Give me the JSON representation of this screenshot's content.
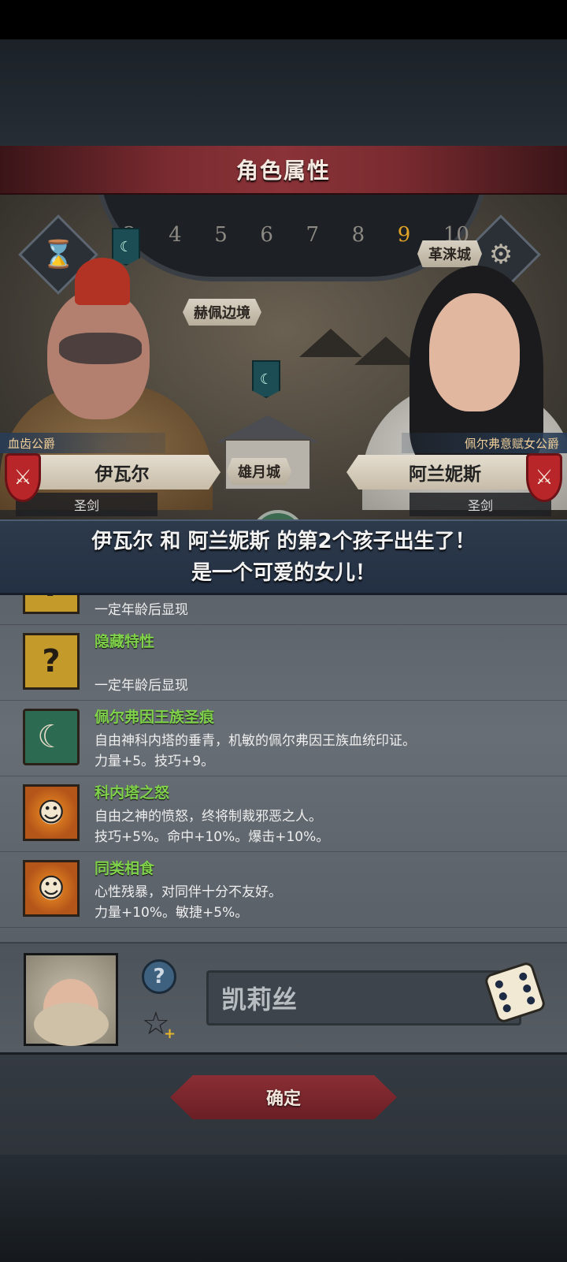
{
  "dialog": {
    "title": "角色属性"
  },
  "map": {
    "wheel_numbers": [
      "3",
      "4",
      "5",
      "6",
      "7",
      "8",
      "9",
      "10"
    ],
    "wheel_highlight": "9",
    "locations": {
      "north_east": "革涞城",
      "west": "赫佩边境",
      "center": "雄月城"
    }
  },
  "father": {
    "title": "血齿公爵",
    "name": "伊瓦尔",
    "class": "圣剑"
  },
  "mother": {
    "title": "佩尔弗意赋女公爵",
    "name": "阿兰妮斯",
    "class": "圣剑"
  },
  "announcement": {
    "line1": "伊瓦尔 和 阿兰妮斯 的第2个孩子出生了！",
    "line2": "是一个可爱的女儿！"
  },
  "traits": [
    {
      "icon": "question-icon",
      "name": "",
      "desc1": "",
      "desc2": "一定年龄后显现"
    },
    {
      "icon": "question-icon",
      "name": "隐藏特性",
      "desc1": "",
      "desc2": "一定年龄后显现"
    },
    {
      "icon": "moon-icon",
      "name": "佩尔弗因王族圣痕",
      "desc1": "自由神科内塔的垂青，机敏的佩尔弗因王族血统印证。",
      "desc2": "力量+5。技巧+9。"
    },
    {
      "icon": "smiley-sun-icon",
      "name": "科内塔之怒",
      "desc1": "自由之神的愤怒，终将制裁邪恶之人。",
      "desc2": "技巧+5%。命中+10%。爆击+10%。"
    },
    {
      "icon": "smiley-sun-icon",
      "name": "同类相食",
      "desc1": "心性残暴，对同伴十分不友好。",
      "desc2": "力量+10%。敏捷+5%。"
    }
  ],
  "child": {
    "name_value": "凯莉丝"
  },
  "footer": {
    "confirm_label": "确定"
  },
  "colors": {
    "accent_red": "#8a2e34",
    "trait_green": "#7fd24a",
    "announce_blue": "#2d3a4c"
  }
}
